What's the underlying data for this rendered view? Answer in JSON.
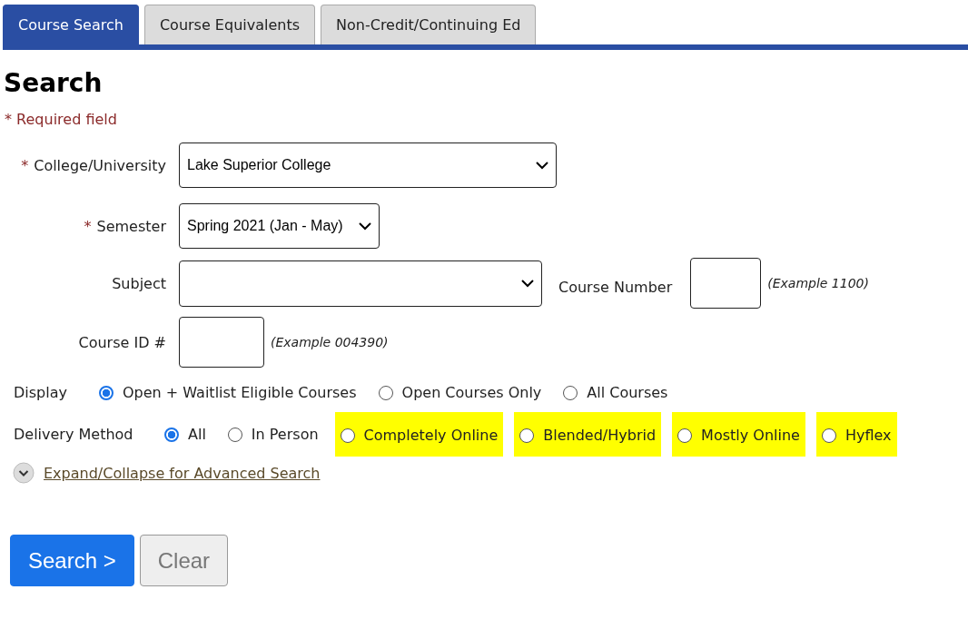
{
  "tabs": [
    {
      "label": "Course Search",
      "selected": true
    },
    {
      "label": "Course Equivalents",
      "selected": false
    },
    {
      "label": "Non-Credit/Continuing Ed",
      "selected": false
    }
  ],
  "heading": "Search",
  "required_note": "* Required field",
  "fields": {
    "college": {
      "required_mark": "*",
      "label": "College/University",
      "value": "Lake Superior College"
    },
    "semester": {
      "required_mark": "*",
      "label": "Semester",
      "value": "Spring 2021 (Jan - May)"
    },
    "subject": {
      "label": "Subject"
    },
    "course_number": {
      "label": "Course Number",
      "hint": "(Example 1100)"
    },
    "course_id": {
      "label": "Course ID #",
      "hint": "(Example 004390)"
    }
  },
  "display": {
    "label": "Display",
    "options": [
      {
        "label": "Open + Waitlist Eligible Courses",
        "selected": true
      },
      {
        "label": "Open Courses Only",
        "selected": false
      },
      {
        "label": "All Courses",
        "selected": false
      }
    ]
  },
  "delivery": {
    "label": "Delivery Method",
    "options": [
      {
        "label": "All",
        "selected": true,
        "highlighted": false
      },
      {
        "label": "In Person",
        "selected": false,
        "highlighted": false
      },
      {
        "label": "Completely Online",
        "selected": false,
        "highlighted": true
      },
      {
        "label": "Blended/Hybrid",
        "selected": false,
        "highlighted": true
      },
      {
        "label": "Mostly Online",
        "selected": false,
        "highlighted": true
      },
      {
        "label": "Hyflex",
        "selected": false,
        "highlighted": true
      }
    ]
  },
  "advanced_link": "Expand/Collapse for Advanced Search",
  "buttons": [
    {
      "label": "Search >",
      "kind": "primary"
    },
    {
      "label": "Clear",
      "kind": "secondary"
    }
  ]
}
